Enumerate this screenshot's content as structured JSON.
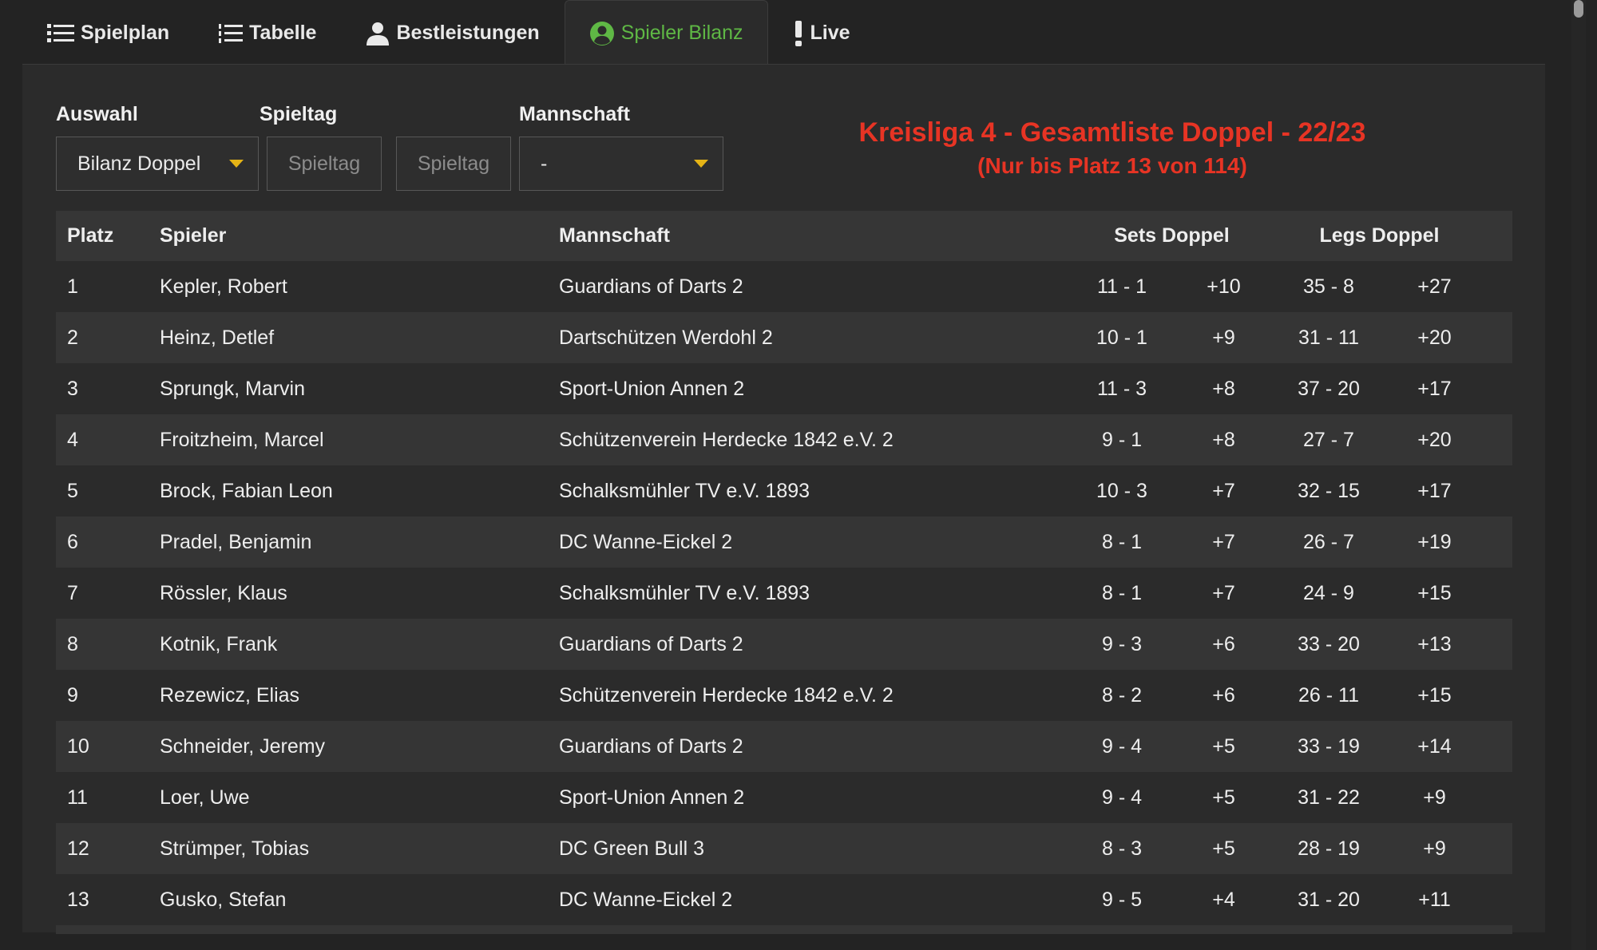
{
  "nav": {
    "items": [
      {
        "label": "Spielplan",
        "icon": "list-icon",
        "active": false
      },
      {
        "label": "Tabelle",
        "icon": "numbered-list-icon",
        "active": false
      },
      {
        "label": "Bestleistungen",
        "icon": "user-icon",
        "active": false
      },
      {
        "label": "Spieler Bilanz",
        "icon": "user-circle-icon",
        "active": true
      },
      {
        "label": "Live",
        "icon": "exclamation-icon",
        "active": false
      }
    ]
  },
  "filters": {
    "auswahl_label": "Auswahl",
    "spieltag_label": "Spieltag",
    "mannschaft_label": "Mannschaft",
    "auswahl_value": "Bilanz Doppel",
    "spieltag_from_placeholder": "Spieltag",
    "spieltag_to_placeholder": "Spieltag",
    "mannschaft_value": "-"
  },
  "headline": {
    "title": "Kreisliga 4 - Gesamtliste Doppel - 22/23",
    "subtitle": "(Nur bis Platz 13 von 114)"
  },
  "table": {
    "headers": {
      "platz": "Platz",
      "spieler": "Spieler",
      "mannschaft": "Mannschaft",
      "sets": "Sets Doppel",
      "legs": "Legs Doppel"
    },
    "rows": [
      {
        "platz": "1",
        "spieler": "Kepler, Robert",
        "mannschaft": "Guardians of Darts 2",
        "sets": "11 - 1",
        "sets_diff": "+10",
        "legs": "35 - 8",
        "legs_diff": "+27"
      },
      {
        "platz": "2",
        "spieler": "Heinz, Detlef",
        "mannschaft": "Dartschützen Werdohl 2",
        "sets": "10 - 1",
        "sets_diff": "+9",
        "legs": "31 - 11",
        "legs_diff": "+20"
      },
      {
        "platz": "3",
        "spieler": "Sprungk, Marvin",
        "mannschaft": "Sport-Union Annen 2",
        "sets": "11 - 3",
        "sets_diff": "+8",
        "legs": "37 - 20",
        "legs_diff": "+17"
      },
      {
        "platz": "4",
        "spieler": "Froitzheim, Marcel",
        "mannschaft": "Schützenverein Herdecke 1842 e.V. 2",
        "sets": "9 - 1",
        "sets_diff": "+8",
        "legs": "27 - 7",
        "legs_diff": "+20"
      },
      {
        "platz": "5",
        "spieler": "Brock, Fabian Leon",
        "mannschaft": "Schalksmühler TV e.V. 1893",
        "sets": "10 - 3",
        "sets_diff": "+7",
        "legs": "32 - 15",
        "legs_diff": "+17"
      },
      {
        "platz": "6",
        "spieler": "Pradel, Benjamin",
        "mannschaft": "DC Wanne-Eickel 2",
        "sets": "8 - 1",
        "sets_diff": "+7",
        "legs": "26 - 7",
        "legs_diff": "+19"
      },
      {
        "platz": "7",
        "spieler": "Rössler, Klaus",
        "mannschaft": "Schalksmühler TV e.V. 1893",
        "sets": "8 - 1",
        "sets_diff": "+7",
        "legs": "24 - 9",
        "legs_diff": "+15"
      },
      {
        "platz": "8",
        "spieler": "Kotnik, Frank",
        "mannschaft": "Guardians of Darts 2",
        "sets": "9 - 3",
        "sets_diff": "+6",
        "legs": "33 - 20",
        "legs_diff": "+13"
      },
      {
        "platz": "9",
        "spieler": "Rezewicz, Elias",
        "mannschaft": "Schützenverein Herdecke 1842 e.V. 2",
        "sets": "8 - 2",
        "sets_diff": "+6",
        "legs": "26 - 11",
        "legs_diff": "+15"
      },
      {
        "platz": "10",
        "spieler": "Schneider, Jeremy",
        "mannschaft": "Guardians of Darts 2",
        "sets": "9 - 4",
        "sets_diff": "+5",
        "legs": "33 - 19",
        "legs_diff": "+14"
      },
      {
        "platz": "11",
        "spieler": "Loer, Uwe",
        "mannschaft": "Sport-Union Annen 2",
        "sets": "9 - 4",
        "sets_diff": "+5",
        "legs": "31 - 22",
        "legs_diff": "+9"
      },
      {
        "platz": "12",
        "spieler": "Strümper, Tobias",
        "mannschaft": "DC Green Bull 3",
        "sets": "8 - 3",
        "sets_diff": "+5",
        "legs": "28 - 19",
        "legs_diff": "+9"
      },
      {
        "platz": "13",
        "spieler": "Gusko, Stefan",
        "mannschaft": "DC Wanne-Eickel 2",
        "sets": "9 - 5",
        "sets_diff": "+4",
        "legs": "31 - 20",
        "legs_diff": "+11"
      }
    ]
  },
  "colors": {
    "background": "#232323",
    "panel": "#2b2b2b",
    "active_tab": "#5fb845",
    "headline": "#e73424",
    "caret": "#e5b416"
  }
}
